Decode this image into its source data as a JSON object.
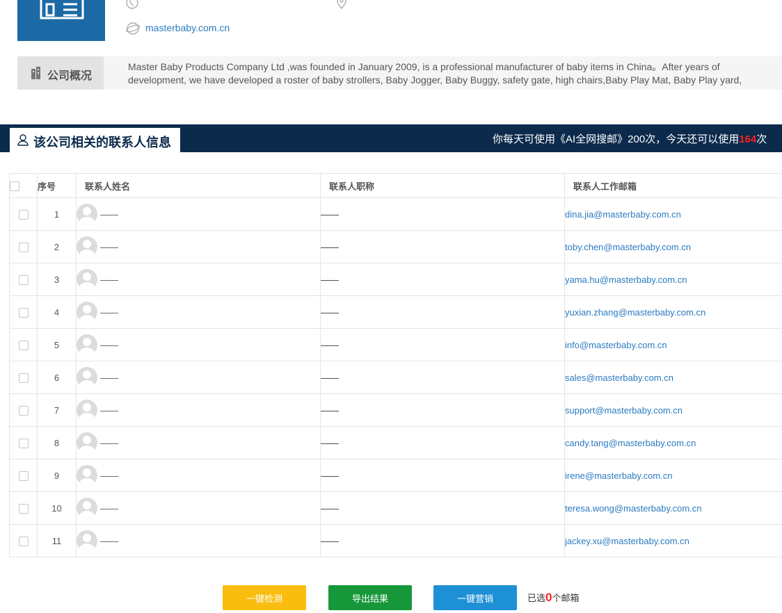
{
  "company": {
    "website": "masterbaby.com.cn",
    "overview_label": "公司概况",
    "overview_text_line1": "Master Baby Products Company Ltd ,was founded in January 2009, is a professional manufacturer of baby items in China。After years of",
    "overview_text_line2": "development, we have developed a roster of baby strollers, Baby Jogger, Baby Buggy, safety gate, high chairs,Baby Play Mat, Baby Play yard,"
  },
  "contacts_section": {
    "title": "该公司相关的联系人信息",
    "quota_prefix": "你每天可使用《AI全网搜邮》200次，今天还可以使用",
    "quota_remaining": "164",
    "quota_suffix": "次"
  },
  "table": {
    "headers": {
      "index": "序号",
      "name": "联系人姓名",
      "title": "联系人职称",
      "email": "联系人工作邮箱"
    },
    "rows": [
      {
        "index": "1",
        "name": "——",
        "title": "——",
        "email": "dina.jia@masterbaby.com.cn"
      },
      {
        "index": "2",
        "name": "——",
        "title": "——",
        "email": "toby.chen@masterbaby.com.cn"
      },
      {
        "index": "3",
        "name": "——",
        "title": "——",
        "email": "yama.hu@masterbaby.com.cn"
      },
      {
        "index": "4",
        "name": "——",
        "title": "——",
        "email": "yuxian.zhang@masterbaby.com.cn"
      },
      {
        "index": "5",
        "name": "——",
        "title": "——",
        "email": "info@masterbaby.com.cn"
      },
      {
        "index": "6",
        "name": "——",
        "title": "——",
        "email": "sales@masterbaby.com.cn"
      },
      {
        "index": "7",
        "name": "——",
        "title": "——",
        "email": "support@masterbaby.com.cn"
      },
      {
        "index": "8",
        "name": "——",
        "title": "——",
        "email": "candy.tang@masterbaby.com.cn"
      },
      {
        "index": "9",
        "name": "——",
        "title": "——",
        "email": "irene@masterbaby.com.cn"
      },
      {
        "index": "10",
        "name": "——",
        "title": "——",
        "email": "teresa.wong@masterbaby.com.cn"
      },
      {
        "index": "11",
        "name": "——",
        "title": "——",
        "email": "jackey.xu@masterbaby.com.cn"
      }
    ]
  },
  "actions": {
    "check_label": "一键检测",
    "export_label": "导出结果",
    "market_label": "一键营销",
    "selected_prefix": "已选",
    "selected_count": "0",
    "selected_suffix": "个邮箱"
  },
  "icons": {
    "logo": "building-logo-icon",
    "phone": "phone-icon",
    "location": "location-pin-icon",
    "website": "globe-icon",
    "overview": "building-bar-icon",
    "contacts": "user-icon",
    "avatar": "default-avatar-icon"
  },
  "colors": {
    "logo_bg": "#1b6aa5",
    "bar_bg": "#0c2a4c",
    "link": "#2b7bc0",
    "highlight": "#ff1d1d",
    "btn_check": "#f9bd10",
    "btn_export": "#16983a",
    "btn_market": "#1e90d6"
  }
}
